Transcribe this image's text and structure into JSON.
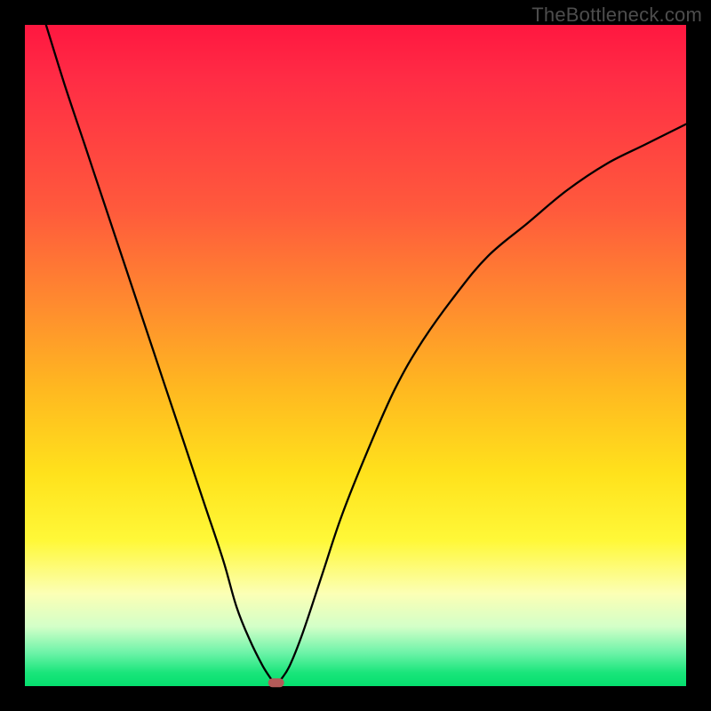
{
  "watermark": "TheBottleneck.com",
  "colors": {
    "frame": "#000000",
    "gradient_top": "#ff1740",
    "gradient_mid": "#ffe21c",
    "gradient_bottom": "#05df6e",
    "curve": "#000000",
    "marker": "#b35a58"
  },
  "chart_data": {
    "type": "line",
    "title": "",
    "xlabel": "",
    "ylabel": "",
    "xlim": [
      0,
      100
    ],
    "ylim": [
      0,
      100
    ],
    "series": [
      {
        "name": "left-branch",
        "x": [
          3.2,
          6,
          9,
          12,
          15,
          18,
          21,
          24,
          27,
          30,
          32,
          34,
          36,
          37.5
        ],
        "values": [
          100,
          91,
          82,
          73,
          64,
          55,
          46,
          37,
          28,
          19,
          12,
          7,
          3,
          0.7
        ]
      },
      {
        "name": "right-branch",
        "x": [
          38.5,
          40,
          42,
          45,
          48,
          52,
          56,
          60,
          65,
          70,
          76,
          82,
          88,
          94,
          100
        ],
        "values": [
          0.7,
          3,
          8,
          17,
          26,
          36,
          45,
          52,
          59,
          65,
          70,
          75,
          79,
          82,
          85
        ]
      }
    ],
    "marker": {
      "x": 38,
      "y": 0.5
    },
    "annotations": []
  }
}
